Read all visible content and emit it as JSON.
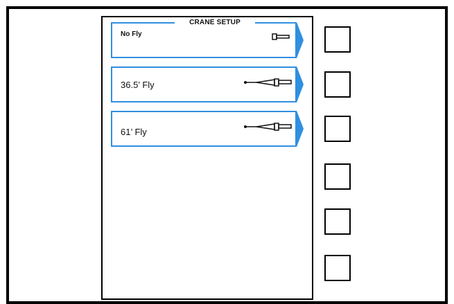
{
  "screen": {
    "title": "CRANE SETUP"
  },
  "menu": [
    {
      "label": "No Fly",
      "icon": "boom-no-fly-icon"
    },
    {
      "label": "36.5’ Fly",
      "icon": "boom-with-fly-icon"
    },
    {
      "label": "61’ Fly",
      "icon": "boom-with-fly-icon"
    }
  ],
  "softkeys": {
    "count": 6
  },
  "colors": {
    "accent": "#2f8fe0",
    "frame": "#000000"
  }
}
